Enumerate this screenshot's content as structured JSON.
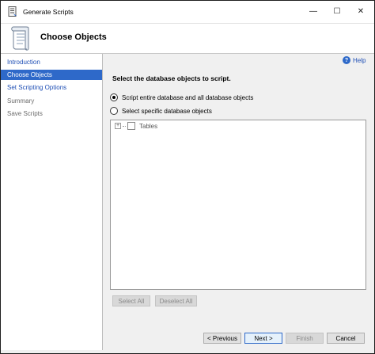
{
  "window": {
    "title": "Generate Scripts",
    "minimize_glyph": "—",
    "maximize_glyph": "☐",
    "close_glyph": "✕"
  },
  "banner": {
    "title": "Choose Objects",
    "icon": "script-scroll-icon"
  },
  "sidebar": {
    "items": [
      {
        "label": "Introduction",
        "state": "link"
      },
      {
        "label": "Choose Objects",
        "state": "active"
      },
      {
        "label": "Set Scripting Options",
        "state": "link"
      },
      {
        "label": "Summary",
        "state": "disabled"
      },
      {
        "label": "Save Scripts",
        "state": "disabled"
      }
    ]
  },
  "help": {
    "label": "Help",
    "icon_glyph": "?"
  },
  "main": {
    "instruction": "Select the database objects to script.",
    "options": [
      {
        "label": "Script entire database and all database objects",
        "checked": true
      },
      {
        "label": "Select specific database objects",
        "checked": false
      }
    ],
    "tree": {
      "items": [
        {
          "label": "Tables",
          "expander": "+"
        }
      ]
    },
    "select_all_label": "Select All",
    "deselect_all_label": "Deselect All"
  },
  "footer": {
    "previous_label": "< Previous",
    "next_label": "Next >",
    "finish_label": "Finish",
    "cancel_label": "Cancel"
  },
  "colors": {
    "accent": "#2e69c9",
    "link": "#1f4fb5"
  }
}
